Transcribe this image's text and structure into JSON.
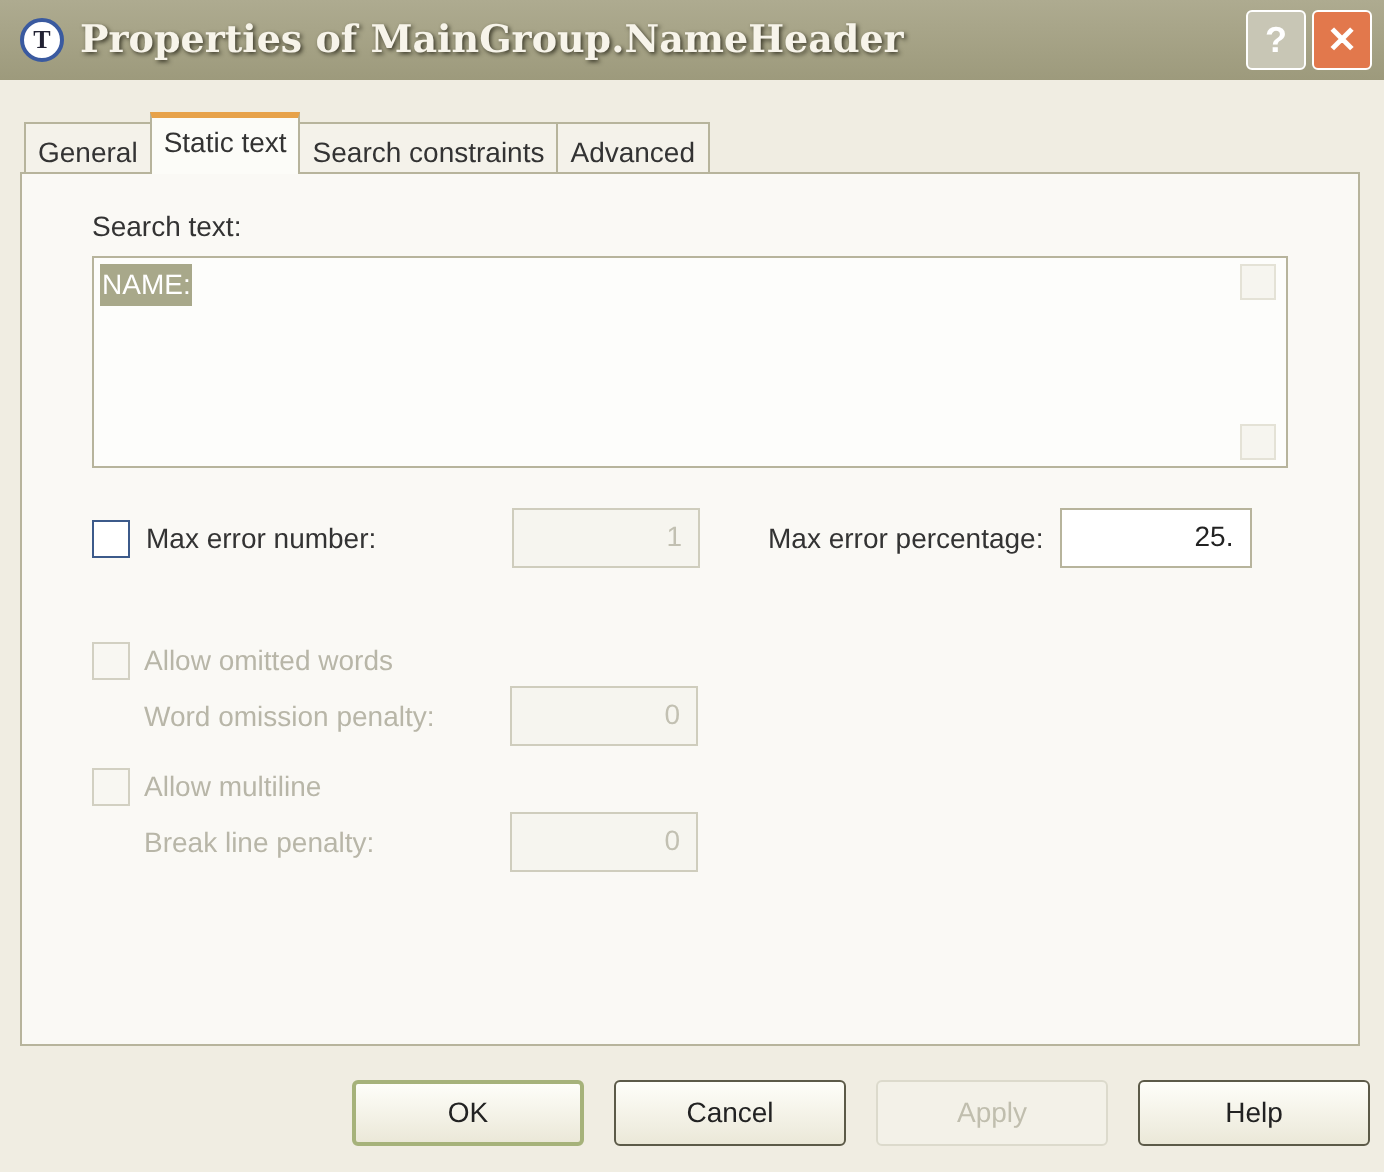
{
  "window": {
    "title": "Properties of MainGroup.NameHeader",
    "icon": "T"
  },
  "title_buttons": [
    {
      "kind": "help",
      "label": "?"
    },
    {
      "kind": "close",
      "label": "✕"
    }
  ],
  "tabs": [
    {
      "label": "General",
      "selected": false
    },
    {
      "label": "Static text",
      "selected": true
    },
    {
      "label": "Search constraints",
      "selected": false
    },
    {
      "label": "Advanced",
      "selected": false
    }
  ],
  "search_text": {
    "label": "Search text:",
    "value": "NAME:",
    "highlighted": true
  },
  "max_error_number": {
    "label": "Max error number:",
    "checked": false,
    "disabled": false,
    "value": "1",
    "value_disabled": true
  },
  "max_error_percentage": {
    "label": "Max error percentage:",
    "value": "25."
  },
  "allow_omitted_words": {
    "label": "Allow omitted words",
    "checked": false,
    "disabled": true,
    "penalty_label": "Word omission penalty:",
    "penalty": "0"
  },
  "allow_multiline": {
    "label": "Allow multiline",
    "checked": false,
    "disabled": true,
    "penalty_label": "Break line penalty:",
    "penalty": "0"
  },
  "buttons": [
    {
      "label": "OK",
      "default": true,
      "disabled": false
    },
    {
      "label": "Cancel",
      "default": false,
      "disabled": false
    },
    {
      "label": "Apply",
      "default": false,
      "disabled": true
    },
    {
      "label": "Help",
      "default": false,
      "disabled": false
    }
  ]
}
